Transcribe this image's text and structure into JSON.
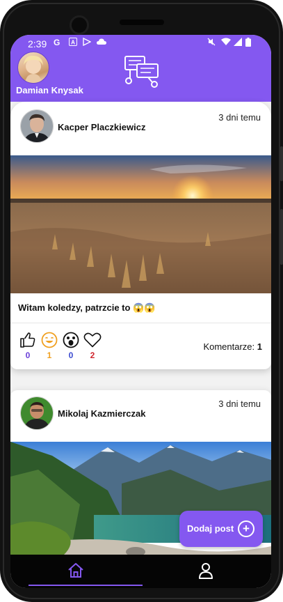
{
  "status_bar": {
    "time": "2:39",
    "icons": [
      "google-icon",
      "text-icon",
      "play-store-icon",
      "cloud-icon",
      "mute-icon",
      "wifi-icon",
      "signal-icon",
      "battery-icon"
    ]
  },
  "header": {
    "user_name": "Damian Knysak",
    "logo_icon": "chat-network-icon",
    "background_color": "#8458f0"
  },
  "posts": [
    {
      "author": "Kacper Placzkiewicz",
      "time": "3 dni temu",
      "text": "Witam koledzy, patrzcie to 😱😱",
      "image": "desert-sunset-photo",
      "reactions": {
        "like": "0",
        "laugh": "1",
        "wow": "0",
        "love": "2"
      },
      "comments_label": "Komentarze:",
      "comments_count": "1"
    },
    {
      "author": "Mikolaj Kazmierczak",
      "time": "3 dni temu",
      "image": "mountain-lake-photo"
    }
  ],
  "reaction_colors": {
    "like": "#6a3fd8",
    "laugh": "#f0a020",
    "wow": "#3a4ad0",
    "love": "#d0262e"
  },
  "add_post": {
    "label": "Dodaj post",
    "icon": "plus-circle-icon"
  },
  "bottom_nav": {
    "items": [
      {
        "icon": "home-icon",
        "active": true
      },
      {
        "icon": "profile-icon",
        "active": false
      }
    ],
    "accent": "#8458f0"
  }
}
